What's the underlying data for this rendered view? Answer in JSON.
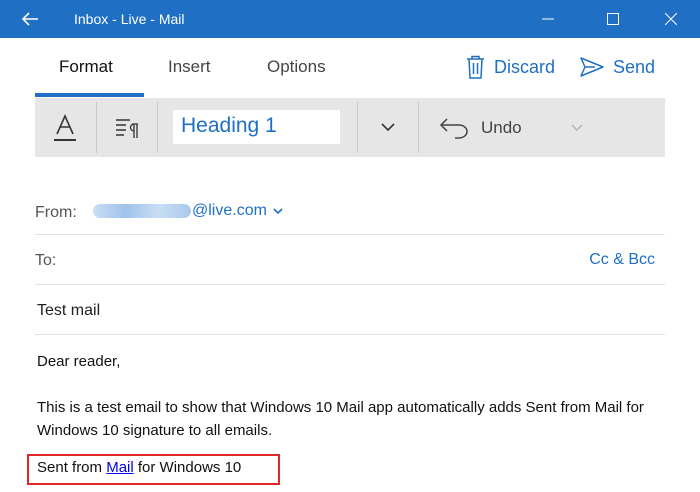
{
  "window": {
    "title": "Inbox - Live - Mail",
    "back_icon": "arrow-left-icon",
    "controls": [
      "minimize-icon",
      "maximize-icon",
      "close-icon"
    ]
  },
  "tabs": [
    {
      "label": "Format",
      "active": true
    },
    {
      "label": "Insert",
      "active": false
    },
    {
      "label": "Options",
      "active": false
    }
  ],
  "actions": {
    "discard_label": "Discard",
    "discard_icon": "trash-icon",
    "send_label": "Send",
    "send_icon": "send-icon"
  },
  "ribbon": {
    "font_icon": "font-format-icon",
    "paragraph_icon": "paragraph-format-icon",
    "style_value": "Heading 1",
    "dropdown_icon": "chevron-down-icon",
    "undo_label": "Undo",
    "undo_icon": "undo-icon"
  },
  "compose": {
    "from_label": "From:",
    "from_address_domain": "@live.com",
    "to_label": "To:",
    "cc_bcc_label": "Cc & Bcc",
    "subject": "Test mail",
    "greeting": "Dear reader,",
    "body": "This is a test email to show that Windows 10 Mail app automatically adds Sent from Mail for Windows 10 signature to all emails.",
    "signature": {
      "prefix": "Sent from ",
      "link": "Mail",
      "suffix": " for Windows 10"
    }
  },
  "colors": {
    "accent": "#1f6fc5",
    "highlight_border": "#e0262b",
    "link": "#0000ee"
  }
}
